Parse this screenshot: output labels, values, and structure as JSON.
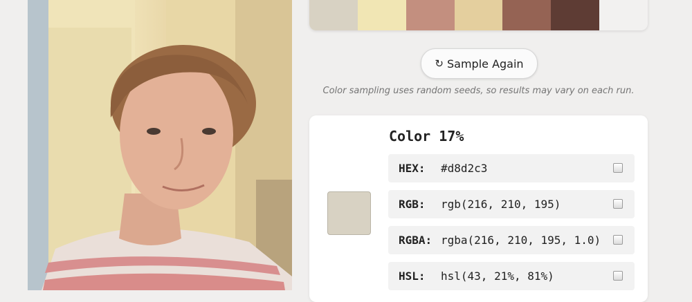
{
  "palette": {
    "swatches": [
      {
        "color": "#d8d2c3"
      },
      {
        "color": "#f1e6b4"
      },
      {
        "color": "#c38f7f"
      },
      {
        "color": "#e4cf9e"
      },
      {
        "color": "#956354"
      },
      {
        "color": "#5e3c34"
      },
      {
        "color": "#f2f1f0"
      }
    ]
  },
  "sample_button": {
    "icon": "refresh-icon",
    "glyph": "↻",
    "label": "Sample Again"
  },
  "note": "Color sampling uses random seeds, so results may vary on each run.",
  "color_card": {
    "title": "Color 17%",
    "swatch_color": "#d8d2c3",
    "rows": [
      {
        "label": "HEX:",
        "value": "#d8d2c3"
      },
      {
        "label": "RGB:",
        "value": "rgb(216, 210, 195)"
      },
      {
        "label": "RGBA:",
        "value": "rgba(216, 210, 195, 1.0)"
      },
      {
        "label": "HSL:",
        "value": "hsl(43, 21%, 81%)"
      }
    ]
  }
}
